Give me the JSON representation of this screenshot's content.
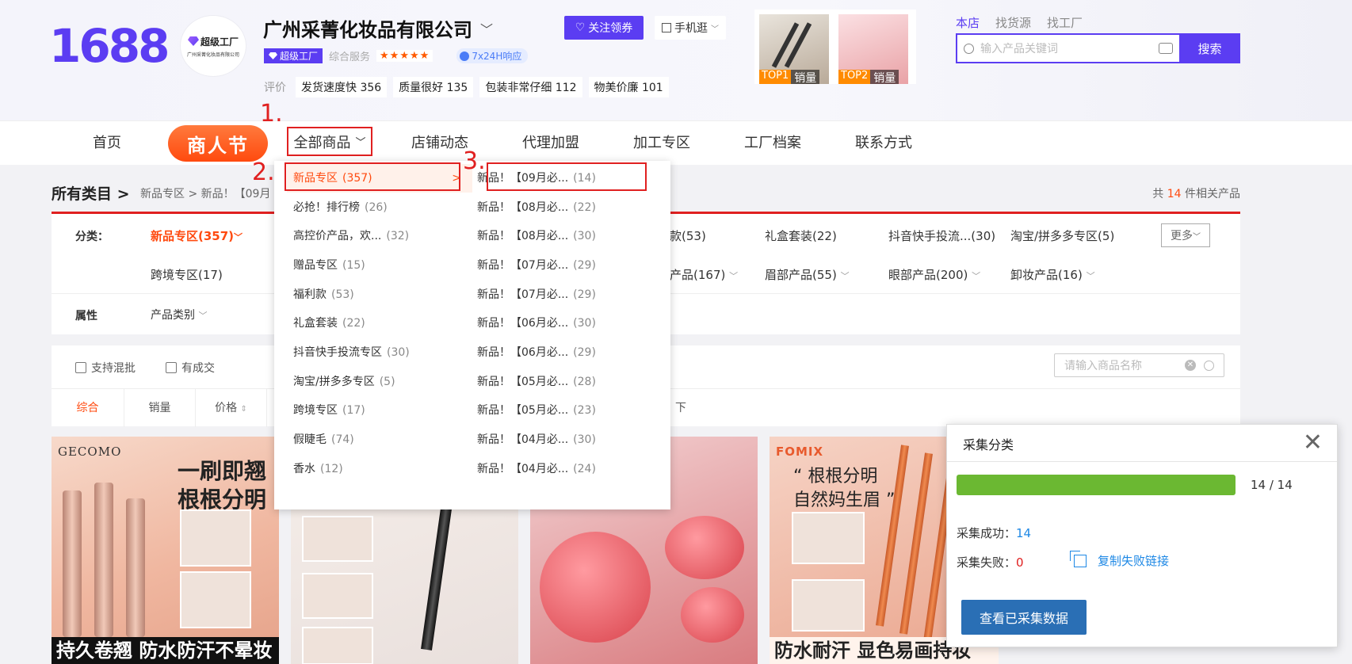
{
  "header": {
    "logo": "1688",
    "avatar_badge": "超级工厂",
    "avatar_sub": "广州采菁化妆品有限公司",
    "shop_name": "广州采菁化妆品有限公司",
    "factory_badge": "超级工厂",
    "service_label": "综合服务",
    "stars": "★★★★★",
    "response": "7x24H响应",
    "review_label": "评价",
    "reviews": [
      "发货速度快 356",
      "质量很好 135",
      "包装非常仔细 112",
      "物美价廉 101"
    ],
    "follow_label": "关注领券",
    "mobile_label": "手机逛",
    "top_products": [
      {
        "rank": "TOP1",
        "label": "销量"
      },
      {
        "rank": "TOP2",
        "label": "销量"
      }
    ],
    "search_tabs": [
      "本店",
      "找货源",
      "找工厂"
    ],
    "search_placeholder": "输入产品关键词",
    "search_button": "搜索"
  },
  "nav": {
    "items": [
      "首页",
      "商人节",
      "全部商品",
      "店铺动态",
      "代理加盟",
      "加工专区",
      "工厂档案",
      "联系方式"
    ]
  },
  "annotations": [
    "1.",
    "2.",
    "3."
  ],
  "breadcrumb": {
    "title": "所有类目 >",
    "path": "新品专区 > 新品！【09月",
    "count_prefix": "共",
    "count": "14",
    "count_suffix": "件相关产品"
  },
  "filter": {
    "category_label": "分类：",
    "row1": [
      "新品专区(357)",
      "款(53)",
      "礼盒套装(22)",
      "抖音快手投流...(30)",
      "淘宝/拼多多专区(5)"
    ],
    "more": "更多",
    "row2": [
      "跨境专区(17)",
      "产品(167)",
      "眉部产品(55)",
      "眼部产品(200)",
      "卸妆产品(16)"
    ],
    "attr_label": "属性",
    "attr_value": "产品类别"
  },
  "sortbar": {
    "check1": "支持混批",
    "check2": "有成交",
    "sorts": [
      "综合",
      "销量",
      "价格"
    ],
    "tail_text": "下",
    "name_placeholder": "请输入商品名称"
  },
  "dropdown": {
    "left": [
      {
        "label": "新品专区",
        "count": "(357)",
        "arrow": ">"
      },
      {
        "label": "必抢！排行榜",
        "count": "(26)"
      },
      {
        "label": "高控价产品，欢...",
        "count": "(32)"
      },
      {
        "label": "赠品专区",
        "count": "(15)"
      },
      {
        "label": "福利款",
        "count": "(53)"
      },
      {
        "label": "礼盒套装",
        "count": "(22)"
      },
      {
        "label": "抖音快手投流专区",
        "count": "(30)"
      },
      {
        "label": "淘宝/拼多多专区",
        "count": "(5)"
      },
      {
        "label": "跨境专区",
        "count": "(17)"
      },
      {
        "label": "假睫毛",
        "count": "(74)"
      },
      {
        "label": "香水",
        "count": "(12)"
      }
    ],
    "right": [
      {
        "label": "新品！【09月必...",
        "count": "(14)"
      },
      {
        "label": "新品！【08月必...",
        "count": "(22)"
      },
      {
        "label": "新品！【08月必...",
        "count": "(30)"
      },
      {
        "label": "新品！【07月必...",
        "count": "(29)"
      },
      {
        "label": "新品！【07月必...",
        "count": "(29)"
      },
      {
        "label": "新品！【06月必...",
        "count": "(30)"
      },
      {
        "label": "新品！【06月必...",
        "count": "(29)"
      },
      {
        "label": "新品！【05月必...",
        "count": "(28)"
      },
      {
        "label": "新品！【05月必...",
        "count": "(23)"
      },
      {
        "label": "新品！【04月必...",
        "count": "(30)"
      },
      {
        "label": "新品！【04月必...",
        "count": "(24)"
      }
    ]
  },
  "products": [
    {
      "brand": "GECOMO",
      "headline": "一刷即翘\n根根分明",
      "footer": "持久卷翘 防水防汗不晕妆"
    },
    {
      "brand": "",
      "headline": "",
      "footer": ""
    },
    {
      "brand": "",
      "headline": "",
      "footer": ""
    },
    {
      "brand": "FOMIX",
      "headline": "“ 根根分明\n自然妈生眉 ”",
      "footer": "防水耐汗 显色易画持妆"
    }
  ],
  "popup": {
    "title": "采集分类",
    "progress": 1.0,
    "progress_text": "14 / 14",
    "success_label": "采集成功：",
    "success_value": "14",
    "fail_label": "采集失败：",
    "fail_value": "0",
    "copy_label": "复制失败链接",
    "view_button": "查看已采集数据"
  },
  "colors": {
    "brand": "#5b3df2",
    "accent": "#ff4a0f",
    "highlight": "#e02020",
    "progress": "#6bb832",
    "button": "#2a6fb5"
  }
}
